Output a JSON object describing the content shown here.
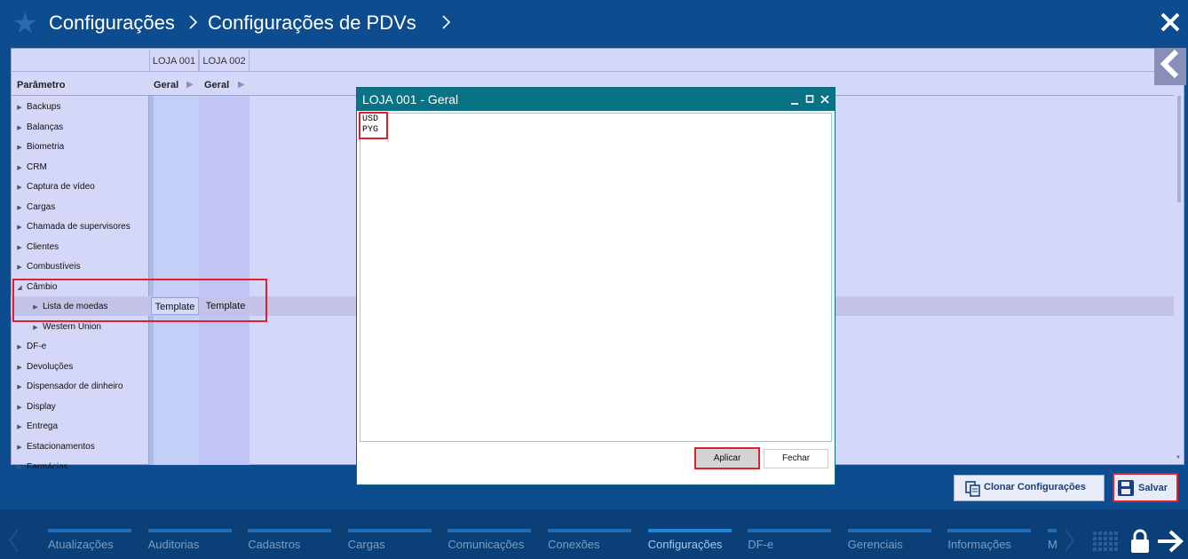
{
  "header": {
    "breadcrumb_1": "Configurações",
    "separator": ">",
    "breadcrumb_2": "Configurações de PDVs",
    "close_icon": "close-icon"
  },
  "grid": {
    "stores": [
      "LOJA 001",
      "LOJA 002"
    ],
    "param_header": "Parâmetro",
    "group_headers": [
      "Geral",
      "Geral"
    ],
    "tree": [
      {
        "label": "Backups",
        "expanded": false,
        "level": 0
      },
      {
        "label": "Balanças",
        "expanded": false,
        "level": 0
      },
      {
        "label": "Biometria",
        "expanded": false,
        "level": 0
      },
      {
        "label": "CRM",
        "expanded": false,
        "level": 0
      },
      {
        "label": "Captura de vídeo",
        "expanded": false,
        "level": 0
      },
      {
        "label": "Cargas",
        "expanded": false,
        "level": 0
      },
      {
        "label": "Chamada de supervisores",
        "expanded": false,
        "level": 0
      },
      {
        "label": "Clientes",
        "expanded": false,
        "level": 0
      },
      {
        "label": "Combustíveis",
        "expanded": false,
        "level": 0
      },
      {
        "label": "Câmbio",
        "expanded": true,
        "level": 0
      },
      {
        "label": "Lista de moedas",
        "expanded": false,
        "level": 1
      },
      {
        "label": "Western Union",
        "expanded": false,
        "level": 1
      },
      {
        "label": "DF-e",
        "expanded": false,
        "level": 0
      },
      {
        "label": "Devoluções",
        "expanded": false,
        "level": 0
      },
      {
        "label": "Dispensador de dinheiro",
        "expanded": false,
        "level": 0
      },
      {
        "label": "Display",
        "expanded": false,
        "level": 0
      },
      {
        "label": "Entrega",
        "expanded": false,
        "level": 0
      },
      {
        "label": "Estacionamentos",
        "expanded": false,
        "level": 0
      },
      {
        "label": "Farmácias",
        "expanded": false,
        "level": 0
      }
    ],
    "selected_row_values": [
      "Template",
      "Template"
    ]
  },
  "modal": {
    "title": "LOJA 001 - Geral",
    "currencies": [
      "USD",
      "PYG"
    ],
    "apply_label": "Aplicar",
    "close_label": "Fechar"
  },
  "actions": {
    "clone_label": "Clonar Configurações",
    "save_label": "Salvar"
  },
  "bottom_nav": {
    "items": [
      "Atualizações",
      "Auditorias",
      "Cadastros",
      "Cargas",
      "Comunicações",
      "Conexões",
      "Configurações",
      "DF-e",
      "Gerenciais",
      "Informações",
      "M"
    ],
    "active": "Configurações"
  },
  "colors": {
    "header_bg": "#0d4d8f",
    "panel_bg": "#d5d7f8",
    "modal_bar": "#0a7285",
    "highlight": "#e0202a",
    "nav_bg": "#0a3f78",
    "nav_active": "#1e77c6"
  }
}
